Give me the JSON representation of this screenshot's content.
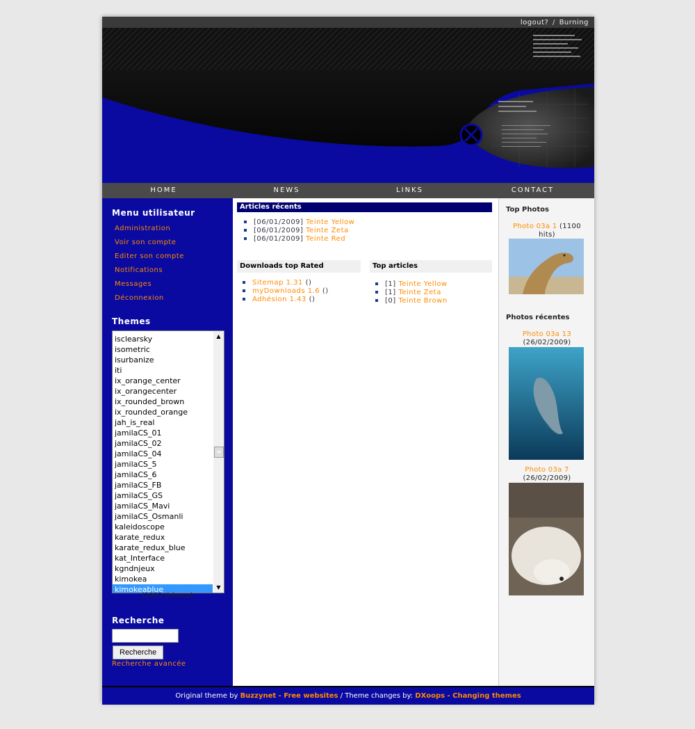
{
  "topbar": {
    "logout": "logout?",
    "sep": "/",
    "user": "Burning"
  },
  "nav": [
    "HOME",
    "NEWS",
    "LINKS",
    "CONTACT"
  ],
  "usermenu": {
    "title": "Menu utilisateur",
    "items": [
      "Administration",
      "Voir son compte",
      "Editer son compte",
      "Notifications",
      "Messages",
      "Déconnexion"
    ]
  },
  "themes": {
    "title": "Themes",
    "items": [
      "isclearsky",
      "isometric",
      "isurbanize",
      "iti",
      "ix_orange_center",
      "ix_orangecenter",
      "ix_rounded_brown",
      "ix_rounded_orange",
      "jah_is_real",
      "jamilaCS_01",
      "jamilaCS_02",
      "jamilaCS_04",
      "jamilaCS_5",
      "jamilaCS_6",
      "jamilaCS_FB",
      "jamilaCS_GS",
      "jamilaCS_Mavi",
      "jamilaCS_Osmanli",
      "kaleidoscope",
      "karate_redux",
      "karate_redux_blue",
      "kat_Interface",
      "kgndnjeux",
      "kimokea",
      "kimokeablue"
    ],
    "selected": "kimokeablue",
    "count": "(1893 thèmes)"
  },
  "search": {
    "title": "Recherche",
    "button": "Recherche",
    "advanced": "Recherche avancée",
    "value": ""
  },
  "recent_articles": {
    "title": "Articles récents",
    "items": [
      {
        "date": "[06/01/2009]",
        "title": "Teinte Yellow"
      },
      {
        "date": "[06/01/2009]",
        "title": "Teinte Zeta"
      },
      {
        "date": "[06/01/2009]",
        "title": "Teinte Red"
      }
    ]
  },
  "downloads_top": {
    "title": "Downloads top Rated",
    "items": [
      {
        "name": "Sitemap 1.31",
        "extra": "()"
      },
      {
        "name": "myDownloads 1.6",
        "extra": "()"
      },
      {
        "name": "Adhésion 1.43",
        "extra": "()"
      }
    ]
  },
  "top_articles": {
    "title": "Top articles",
    "items": [
      {
        "count": "[1]",
        "title": "Teinte Yellow"
      },
      {
        "count": "[1]",
        "title": "Teinte Zeta"
      },
      {
        "count": "[0]",
        "title": "Teinte Brown"
      }
    ]
  },
  "top_photos": {
    "title": "Top Photos",
    "item": {
      "name": "Photo 03a 1",
      "meta": "(1100 hits)"
    }
  },
  "recent_photos": {
    "title": "Photos récentes",
    "items": [
      {
        "name": "Photo 03a 13",
        "meta": "(26/02/2009)"
      },
      {
        "name": "Photo 03a 7",
        "meta": "(26/02/2009)"
      }
    ]
  },
  "footer": {
    "t1": "Original theme by",
    "l1": "Buzzynet - Free websites",
    "t2": "/ Theme changes by:",
    "l2": "DXoops - Changing themes"
  },
  "colors": {
    "primary_blue": "#0a0aa0",
    "accent_orange": "#ff8a00",
    "article_bar": "#000070"
  }
}
